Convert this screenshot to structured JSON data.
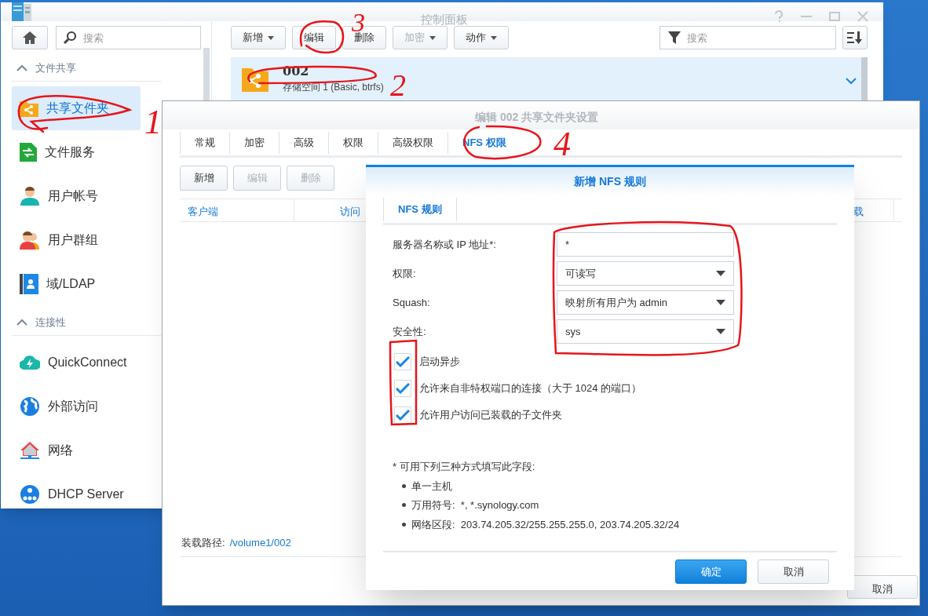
{
  "main_window": {
    "title": "控制面板",
    "sidebar": {
      "search": {
        "placeholder": "搜索"
      },
      "sections": [
        {
          "title": "文件共享",
          "expanded": true,
          "items": [
            {
              "label": "共享文件夹",
              "selected": true
            },
            {
              "label": "文件服务",
              "selected": false
            },
            {
              "label": "用户帐号",
              "selected": false
            },
            {
              "label": "用户群组",
              "selected": false
            },
            {
              "label": "域/LDAP",
              "selected": false
            }
          ]
        },
        {
          "title": "连接性",
          "expanded": true,
          "items": [
            {
              "label": "QuickConnect",
              "selected": false
            },
            {
              "label": "外部访问",
              "selected": false
            },
            {
              "label": "网络",
              "selected": false
            },
            {
              "label": "DHCP Server",
              "selected": false
            }
          ]
        }
      ]
    },
    "toolbar": {
      "buttons": [
        {
          "label": "新增",
          "dropdown": true,
          "disabled": false
        },
        {
          "label": "编辑",
          "dropdown": false,
          "disabled": false
        },
        {
          "label": "删除",
          "dropdown": false,
          "disabled": false
        },
        {
          "label": "加密",
          "dropdown": true,
          "disabled": true
        },
        {
          "label": "动作",
          "dropdown": true,
          "disabled": false
        }
      ],
      "search": {
        "placeholder": "搜索"
      }
    },
    "list": {
      "rows": [
        {
          "name": "002",
          "detail": "存储空间 1 (Basic, btrfs)",
          "selected": true
        }
      ]
    }
  },
  "edit_dialog": {
    "title": "编辑 002 共享文件夹设置",
    "tabs": [
      {
        "label": "常规",
        "selected": false
      },
      {
        "label": "加密",
        "selected": false
      },
      {
        "label": "高级",
        "selected": false
      },
      {
        "label": "权限",
        "selected": false
      },
      {
        "label": "高级权限",
        "selected": false
      },
      {
        "label": "NFS 权限",
        "selected": true
      }
    ],
    "buttons": [
      {
        "label": "新增",
        "disabled": false
      },
      {
        "label": "编辑",
        "disabled": true
      },
      {
        "label": "删除",
        "disabled": true
      }
    ],
    "table": {
      "columns": [
        "客户端",
        "访问",
        "载"
      ]
    },
    "mount_path": {
      "label": "装载路径:",
      "value": "/volume1/002"
    },
    "footer_buttons": [
      "取消"
    ]
  },
  "nfs_dialog": {
    "title": "新增 NFS 规则",
    "tabs": [
      {
        "label": "NFS 规则",
        "selected": true
      }
    ],
    "fields": [
      {
        "label": "服务器名称或 IP 地址*:",
        "kind": "text",
        "value": "*"
      },
      {
        "label": "权限:",
        "kind": "select",
        "value": "可读写"
      },
      {
        "label": "Squash:",
        "kind": "select",
        "value": "映射所有用户为 admin"
      },
      {
        "label": "安全性:",
        "kind": "select",
        "value": "sys"
      }
    ],
    "options": [
      {
        "label": "启动异步",
        "checked": true
      },
      {
        "label": "允许来自非特权端口的连接（大于 1024 的端口）",
        "checked": true
      },
      {
        "label": "允许用户访问已装载的子文件夹",
        "checked": true
      }
    ],
    "note": {
      "title": "* 可用下列三种方式填写此字段:",
      "items": [
        "单一主机",
        "万用符号:  *, *.synology.com",
        "网络区段:  203.74.205.32/255.255.255.0, 203.74.205.32/24"
      ]
    },
    "buttons": [
      {
        "label": "确定",
        "primary": true
      },
      {
        "label": "取消",
        "primary": false
      }
    ]
  },
  "annotations": [
    {
      "label": "1"
    },
    {
      "label": "2"
    },
    {
      "label": "3"
    },
    {
      "label": "4"
    }
  ]
}
